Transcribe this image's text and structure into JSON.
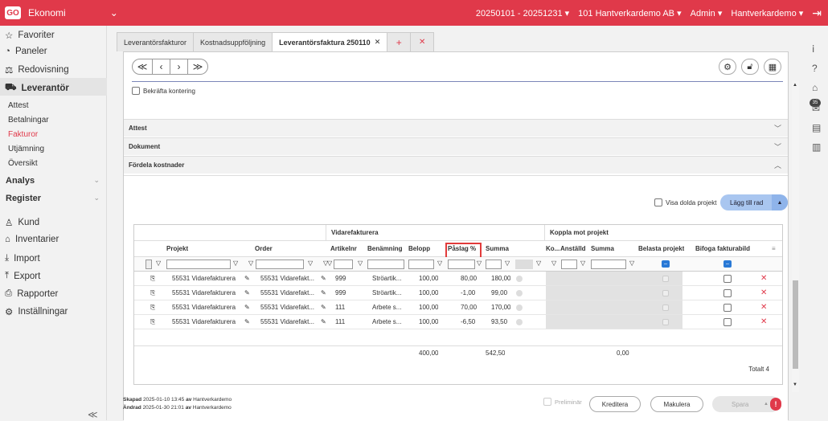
{
  "topbar": {
    "logo": "GO",
    "app": "Ekonomi",
    "period": "20250101 - 20251231 ▾",
    "company": "101 Hantverkardemo AB ▾",
    "user": "Admin ▾",
    "role": "Hantverkardemo ▾"
  },
  "sidebar": {
    "favoriter": "Favoriter",
    "paneler": "Paneler",
    "redovisning": "Redovisning",
    "leverantor": "Leverantör",
    "attest": "Attest",
    "betalningar": "Betalningar",
    "fakturor": "Fakturor",
    "utjamning": "Utjämning",
    "oversikt": "Översikt",
    "analys": "Analys",
    "register": "Register",
    "kund": "Kund",
    "inventarier": "Inventarier",
    "import": "Import",
    "export": "Export",
    "rapporter": "Rapporter",
    "installningar": "Inställningar"
  },
  "tabs": {
    "t1": "Leverantörsfakturor",
    "t2": "Kostnadsuppföljning",
    "t3": "Leverantörsfaktura 250110",
    "close": "✕",
    "plus": "+",
    "x": "✕"
  },
  "nav": {
    "first": "≪",
    "prev": "‹",
    "next": "›",
    "last": "≫"
  },
  "bekrafta": "Bekräfta kontering",
  "sections": {
    "attest": "Attest",
    "dokument": "Dokument",
    "fordela": "Fördela kostnader"
  },
  "visa_dolda": "Visa dolda projekt",
  "lagg_till": "Lägg till rad",
  "grid": {
    "group1": "Vidarefakturera",
    "group2": "Koppla mot projekt",
    "headers": {
      "projekt": "Projekt",
      "order": "Order",
      "artikelnr": "Artikelnr",
      "benamning": "Benämning",
      "belopp": "Belopp",
      "paslag": "Påslag %",
      "summa": "Summa",
      "ko": "Ko...",
      "anstalld": "Anställd",
      "summa2": "Summa",
      "belasta": "Belasta projekt",
      "bifoga": "Bifoga fakturabild"
    },
    "rows": [
      {
        "projekt": "55531 Vidarefakturera",
        "order": "55531 Vidarefakt...",
        "artikel": "999",
        "benamning": "Ströartik...",
        "belopp": "100,00",
        "paslag": "80,00",
        "summa": "180,00"
      },
      {
        "projekt": "55531 Vidarefakturera",
        "order": "55531 Vidarefakt...",
        "artikel": "999",
        "benamning": "Ströartik...",
        "belopp": "100,00",
        "paslag": "-1,00",
        "summa": "99,00"
      },
      {
        "projekt": "55531 Vidarefakturera",
        "order": "55531 Vidarefakt...",
        "artikel": "111",
        "benamning": "Arbete s...",
        "belopp": "100,00",
        "paslag": "70,00",
        "summa": "170,00"
      },
      {
        "projekt": "55531 Vidarefakturera",
        "order": "55531 Vidarefakt...",
        "artikel": "111",
        "benamning": "Arbete s...",
        "belopp": "100,00",
        "paslag": "-6,50",
        "summa": "93,50"
      }
    ],
    "foot": {
      "belopp": "400,00",
      "summa": "542,50",
      "summa2": "0,00"
    },
    "total": "Totalt 4"
  },
  "meta": {
    "skapad_label": "Skapad",
    "skapad": "2025-01-10 13:45",
    "av": "av",
    "skapad_by": "Hantverkardemo",
    "andrad_label": "Ändrad",
    "andrad": "2025-01-30 21:01",
    "andrad_by": "Hantverkardemo"
  },
  "bottom": {
    "preliminar": "Preliminär",
    "kreditera": "Kreditera",
    "makulera": "Makulera",
    "spara": "Spara"
  },
  "badge": "35"
}
